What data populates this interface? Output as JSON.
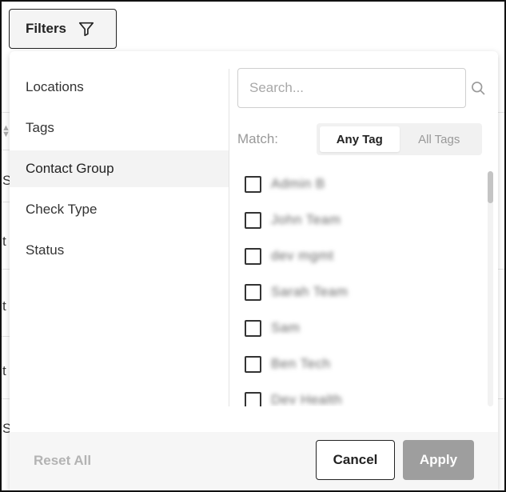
{
  "toolbar": {
    "filters_label": "Filters",
    "filter_icon": "funnel-icon"
  },
  "background": {
    "row_chars": [
      "S",
      "t",
      "t",
      "t",
      "S"
    ]
  },
  "panel": {
    "menu": [
      {
        "label": "Locations",
        "active": false
      },
      {
        "label": "Tags",
        "active": false
      },
      {
        "label": "Contact Group",
        "active": true
      },
      {
        "label": "Check Type",
        "active": false
      },
      {
        "label": "Status",
        "active": false
      }
    ],
    "search": {
      "placeholder": "Search...",
      "value": "",
      "icon": "search-icon"
    },
    "match": {
      "label": "Match:",
      "options": [
        "Any Tag",
        "All Tags"
      ],
      "selected": "Any Tag"
    },
    "groups": [
      {
        "label": "Admin B",
        "checked": false
      },
      {
        "label": "John Team",
        "checked": false
      },
      {
        "label": "dev mgmt",
        "checked": false
      },
      {
        "label": "Sarah Team",
        "checked": false
      },
      {
        "label": "Sam",
        "checked": false
      },
      {
        "label": "Ben Tech",
        "checked": false
      },
      {
        "label": "Dev Health",
        "checked": false
      }
    ]
  },
  "footer": {
    "reset_label": "Reset All",
    "cancel_label": "Cancel",
    "apply_label": "Apply"
  },
  "colors": {
    "border": "#222222",
    "active_menu_bg": "#f3f3f3",
    "apply_disabled": "#9e9e9e",
    "muted_text": "#999999"
  }
}
